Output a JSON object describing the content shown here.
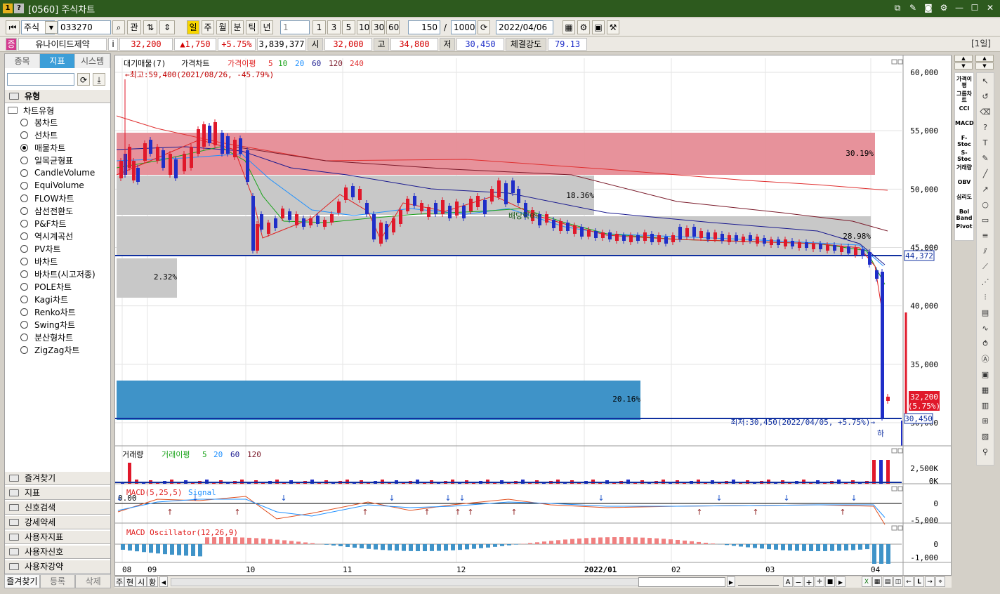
{
  "window": {
    "icons": [
      "1",
      "?"
    ],
    "title": "[0560] 주식차트",
    "buttons": [
      "new-window-icon",
      "edit-icon",
      "camera-icon",
      "settings-icon",
      "minimize-icon",
      "maximize-icon",
      "close-icon"
    ]
  },
  "toolbar": {
    "market": "주식",
    "code": "033270",
    "buttons_a": [
      "관"
    ],
    "periods": [
      "일",
      "주",
      "월",
      "분",
      "틱",
      "년"
    ],
    "period_selected": "일",
    "interval": "1",
    "quick_intervals": [
      "1",
      "3",
      "5",
      "10",
      "30",
      "60"
    ],
    "count": "150",
    "total": "1000",
    "date": "2022/04/06"
  },
  "quote": {
    "badge": "증",
    "name": "유나이티드제약",
    "info": "i",
    "price": "32,200",
    "change": "▲1,750",
    "change_pct": "+5.75%",
    "volume": "3,839,377",
    "open_label": "시",
    "open": "32,000",
    "high_label": "고",
    "high": "34,800",
    "low_label": "저",
    "low": "30,450",
    "strength_label": "체결강도",
    "strength": "79.13",
    "period_tag": "[1일]"
  },
  "left_panel": {
    "tabs": [
      "종목",
      "지표",
      "시스템"
    ],
    "active_tab": "지표",
    "section": "유형",
    "group": "차트유형",
    "chart_types": [
      "봉차트",
      "선차트",
      "매물차트",
      "일목균형표",
      "CandleVolume",
      "EquiVolume",
      "FLOW차트",
      "삼선전환도",
      "P&F차트",
      "역시계곡선",
      "PV차트",
      "바차트",
      "바차트(시고저종)",
      "POLE차트",
      "Kagi차트",
      "Renko차트",
      "Swing차트",
      "분산형차트",
      "ZigZag차트"
    ],
    "selected_type": "매물차트",
    "folders": [
      "즐겨찾기",
      "지표",
      "신호검색",
      "강세약세",
      "사용자지표",
      "사용자신호",
      "사용자강약"
    ],
    "bottom_tabs": [
      "즐겨찾기",
      "등록",
      "삭제"
    ]
  },
  "chart": {
    "price_legend": [
      "대기매물(7)",
      "가격차트",
      "가격이평",
      "5",
      "10",
      "20",
      "60",
      "120",
      "240"
    ],
    "high_note": "←최고:59,400(2021/08/26, -45.79%)",
    "low_note": "최저:30,450(2022/04/05, +5.75%)→",
    "low_marker": "하",
    "dividend_label": "배당락0%",
    "volume_profile_pcts": [
      "30.19%",
      "18.36%",
      "28.98%",
      "2.32%",
      "20.16%"
    ],
    "price_axis": [
      "60,000",
      "55,000",
      "50,000",
      "45,000",
      "40,000",
      "35,000",
      "30,000"
    ],
    "hline_value": "44,372",
    "low_value": "30,450",
    "last_price": "32,200",
    "last_pct": "(5.75%)",
    "volume_legend": [
      "거래량",
      "거래이평",
      "5",
      "20",
      "60",
      "120"
    ],
    "volume_axis": [
      "2,500K",
      "0K"
    ],
    "macd_legend": [
      "MACD(5,25,5)",
      "Signal"
    ],
    "macd_zero_label": "0.00",
    "macd_axis": [
      "0",
      "-5,000"
    ],
    "osc_legend": "MACD Oscillator(12,26,9)",
    "osc_axis": [
      "0",
      "-1,000"
    ],
    "x_labels": [
      "08",
      "09",
      "10",
      "11",
      "12",
      "2022/01",
      "02",
      "03",
      "04"
    ],
    "colors": {
      "up": "#e0182a",
      "down": "#1f2ec8",
      "ma5": "#e02020",
      "ma10": "#1aa31a",
      "ma20": "#1e90ff",
      "ma60": "#1a1a8f",
      "ma120": "#7a1a2a",
      "ma240": "#e03030"
    }
  },
  "bottom": {
    "tabs": [
      "주",
      "현",
      "시",
      "황"
    ]
  },
  "right_tools": {
    "set1": [
      "가격이평",
      "그룹차트",
      "CCI",
      "MACD",
      "F-Stoc",
      "S-Stoc",
      "거래량",
      "OBV",
      "심리도",
      "Bol Band",
      "Pivot"
    ]
  }
}
